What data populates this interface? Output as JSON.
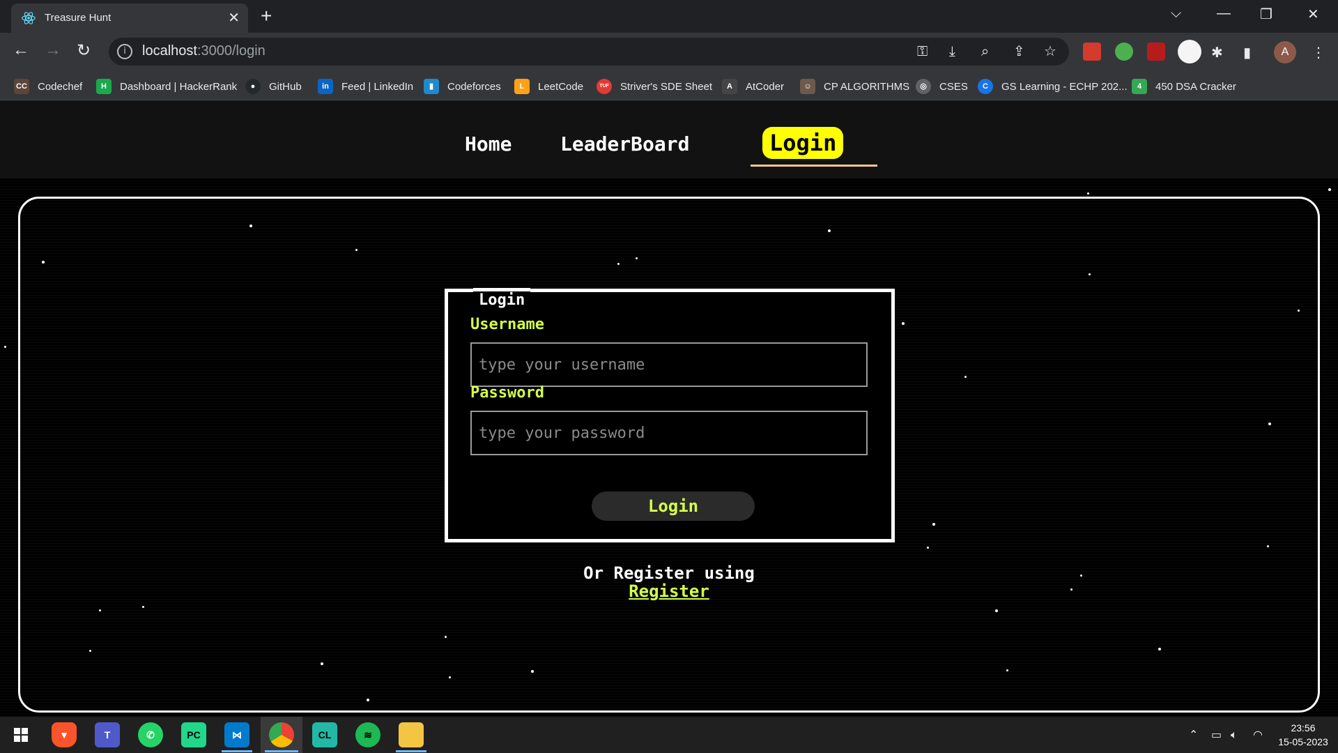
{
  "browser": {
    "tab_title": "Treasure Hunt",
    "url_host": "localhost",
    "url_path": ":3000/login",
    "avatar_letter": "A",
    "bookmarks": [
      {
        "label": "Codechef",
        "icon": "codechef-icon",
        "badge": "CC",
        "color": "#5b4638"
      },
      {
        "label": "Dashboard | HackerRank",
        "icon": "hackerrank-icon",
        "badge": "H",
        "color": "#1ba94c"
      },
      {
        "label": "GitHub",
        "icon": "github-icon",
        "badge": "●",
        "color": "#24292e"
      },
      {
        "label": "Feed | LinkedIn",
        "icon": "linkedin-icon",
        "badge": "in",
        "color": "#0a66c2"
      },
      {
        "label": "Codeforces",
        "icon": "codeforces-icon",
        "badge": "▮",
        "color": "#1f8acb"
      },
      {
        "label": "LeetCode",
        "icon": "leetcode-icon",
        "badge": "L",
        "color": "#ffa116"
      },
      {
        "label": "Striver's SDE Sheet",
        "icon": "tuf-icon",
        "badge": "TUF",
        "color": "#e53935"
      },
      {
        "label": "AtCoder",
        "icon": "atcoder-icon",
        "badge": "A",
        "color": "#444444"
      },
      {
        "label": "CP ALGORITHMS",
        "icon": "cp-algorithms-icon",
        "badge": "☺",
        "color": "#6d5a4a"
      },
      {
        "label": "CSES",
        "icon": "cses-icon",
        "badge": "◎",
        "color": "#5f6368"
      },
      {
        "label": "GS Learning - ECHP 202...",
        "icon": "gs-learning-icon",
        "badge": "C",
        "color": "#1a73e8"
      },
      {
        "label": "450 DSA Cracker",
        "icon": "dsa-cracker-icon",
        "badge": "4",
        "color": "#34a853"
      }
    ]
  },
  "site": {
    "nav": {
      "home": "Home",
      "leaderboard": "LeaderBoard",
      "login": "Login"
    },
    "form": {
      "legend": "Login",
      "username_label": "Username",
      "username_placeholder": "type your username",
      "password_label": "Password",
      "password_placeholder": "type your password",
      "submit": "Login"
    },
    "register_prompt": "Or Register using",
    "register_link": "Register",
    "colors": {
      "accent": "#d4ff4a",
      "active_nav": "#ffff00",
      "underline": "#f5c88a"
    }
  },
  "taskbar": {
    "time": "23:56",
    "date": "15-05-2023",
    "apps": [
      "windows-start-icon",
      "brave-icon",
      "teams-icon",
      "whatsapp-icon",
      "pycharm-icon",
      "vscode-icon",
      "chrome-icon",
      "clion-icon",
      "spotify-icon",
      "file-explorer-icon"
    ]
  }
}
